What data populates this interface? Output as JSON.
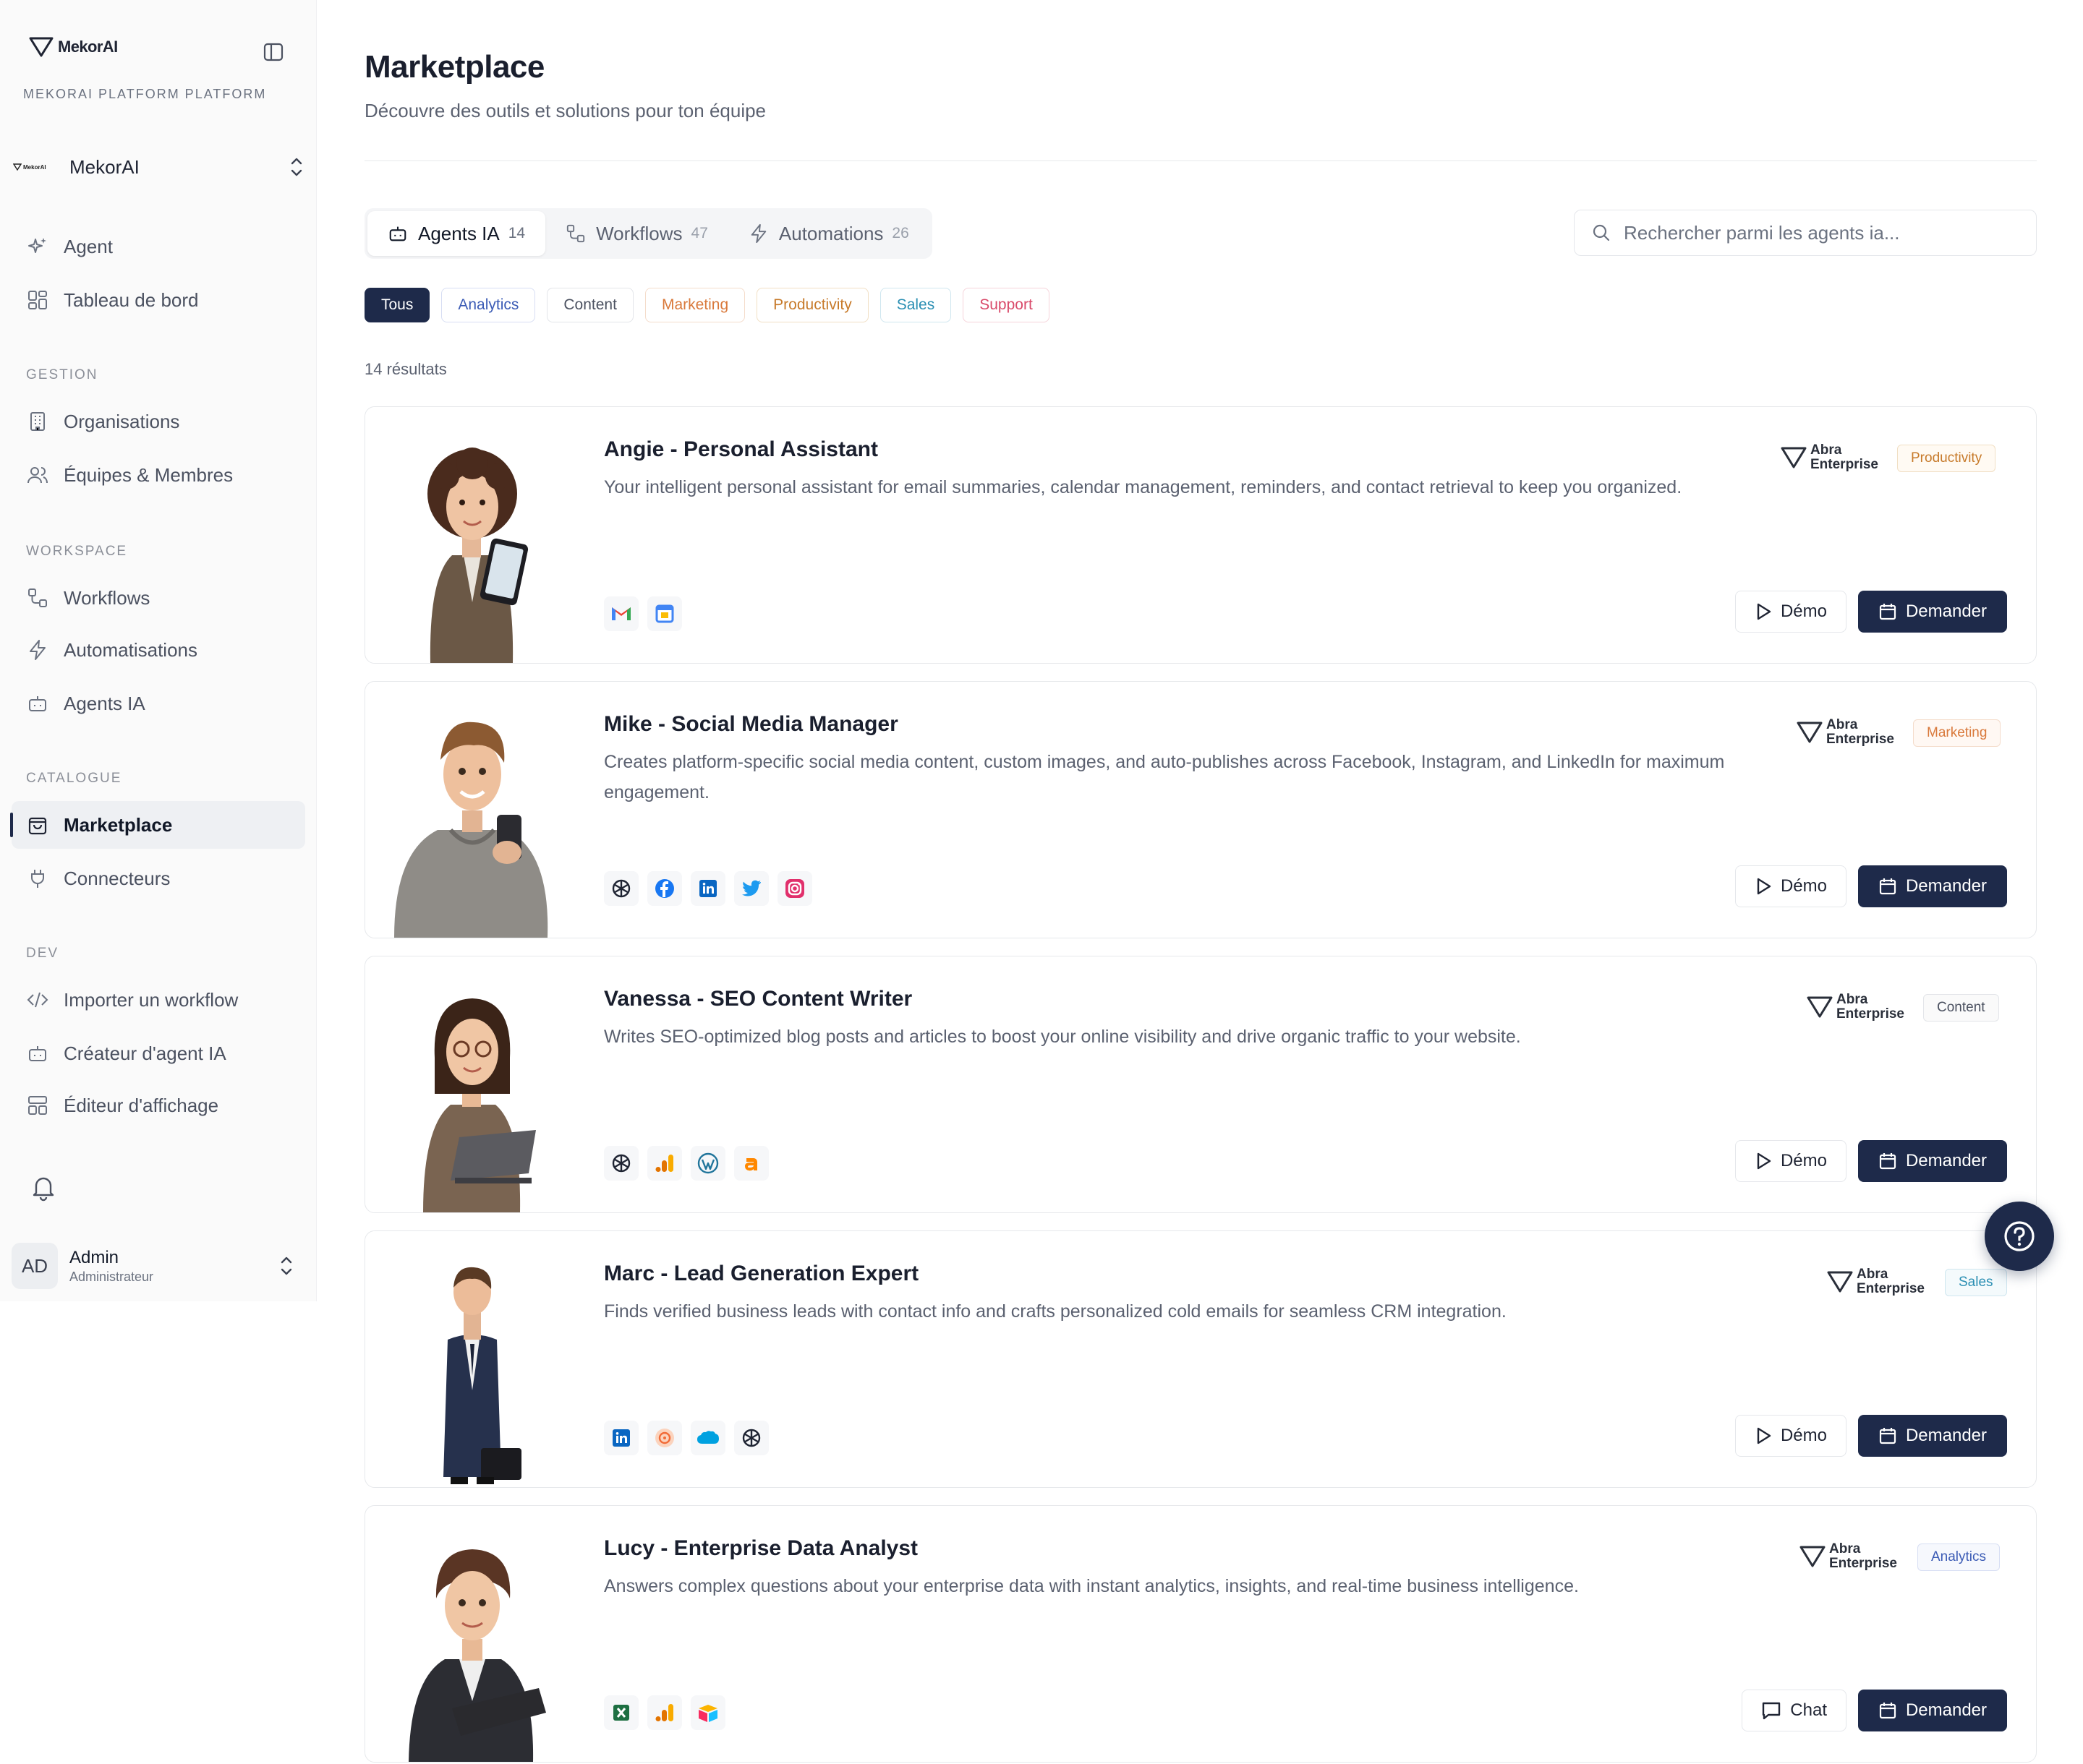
{
  "sidebar": {
    "brand": "MekorAI",
    "platform_caption": "MEKORAI PLATFORM PLATFORM",
    "org": {
      "logo_text": "MekorAI",
      "name": "MekorAI"
    },
    "sections": {
      "gestion": "GESTION",
      "workspace": "WORKSPACE",
      "catalogue": "CATALOGUE",
      "dev": "DEV"
    },
    "items": {
      "agent": "Agent",
      "dashboard": "Tableau de bord",
      "organisations": "Organisations",
      "teams": "Équipes & Membres",
      "workflows": "Workflows",
      "automations": "Automatisations",
      "agents_ia": "Agents IA",
      "marketplace": "Marketplace",
      "connectors": "Connecteurs",
      "import_workflow": "Importer un workflow",
      "agent_creator": "Créateur d'agent IA",
      "display_editor": "Éditeur d'affichage"
    },
    "user": {
      "initials": "AD",
      "name": "Admin",
      "role": "Administrateur"
    }
  },
  "main": {
    "title": "Marketplace",
    "subtitle": "Découvre des outils et solutions pour ton équipe",
    "tabs": [
      {
        "label": "Agents IA",
        "count": "14"
      },
      {
        "label": "Workflows",
        "count": "47"
      },
      {
        "label": "Automations",
        "count": "26"
      }
    ],
    "search_placeholder": "Rechercher parmi les agents ia...",
    "filters": [
      "Tous",
      "Analytics",
      "Content",
      "Marketing",
      "Productivity",
      "Sales",
      "Support"
    ],
    "results": "14 résultats",
    "vendor": {
      "line1": "Abra",
      "line2": "Enterprise"
    },
    "buttons": {
      "demo": "Démo",
      "chat": "Chat",
      "request": "Demander"
    },
    "cards": [
      {
        "title": "Angie - Personal Assistant",
        "description": "Your intelligent personal assistant for email summaries, calendar management, reminders, and contact retrieval to keep you organized.",
        "category": "Productivity",
        "integrations": [
          "gmail-icon",
          "google-calendar-icon"
        ]
      },
      {
        "title": "Mike - Social Media Manager",
        "description": "Creates platform-specific social media content, custom images, and auto-publishes across Facebook, Instagram, and LinkedIn for maximum engagement.",
        "category": "Marketing",
        "integrations": [
          "openai-icon",
          "facebook-icon",
          "linkedin-icon",
          "twitter-icon",
          "instagram-icon"
        ]
      },
      {
        "title": "Vanessa - SEO Content Writer",
        "description": "Writes SEO-optimized blog posts and articles to boost your online visibility and drive organic traffic to your website.",
        "category": "Content",
        "integrations": [
          "openai-icon",
          "google-analytics-icon",
          "wordpress-icon",
          "ahrefs-icon"
        ]
      },
      {
        "title": "Marc - Lead Generation Expert",
        "description": "Finds verified business leads with contact info and crafts personalized cold emails for seamless CRM integration.",
        "category": "Sales",
        "integrations": [
          "linkedin-icon",
          "hunter-icon",
          "salesforce-icon",
          "openai-icon"
        ]
      },
      {
        "title": "Lucy - Enterprise Data Analyst",
        "description": "Answers complex questions about your enterprise data with instant analytics, insights, and real-time business intelligence.",
        "category": "Analytics",
        "integrations": [
          "excel-icon",
          "google-analytics-icon",
          "airtable-icon"
        ]
      }
    ]
  },
  "colors": {
    "navy": "#1e2a4a",
    "analytics": "#3b5bb5",
    "content": "#4b5160",
    "marketing": "#d9793b",
    "productivity": "#c77a2a",
    "sales": "#2b8fb3",
    "support": "#d94a6a"
  }
}
